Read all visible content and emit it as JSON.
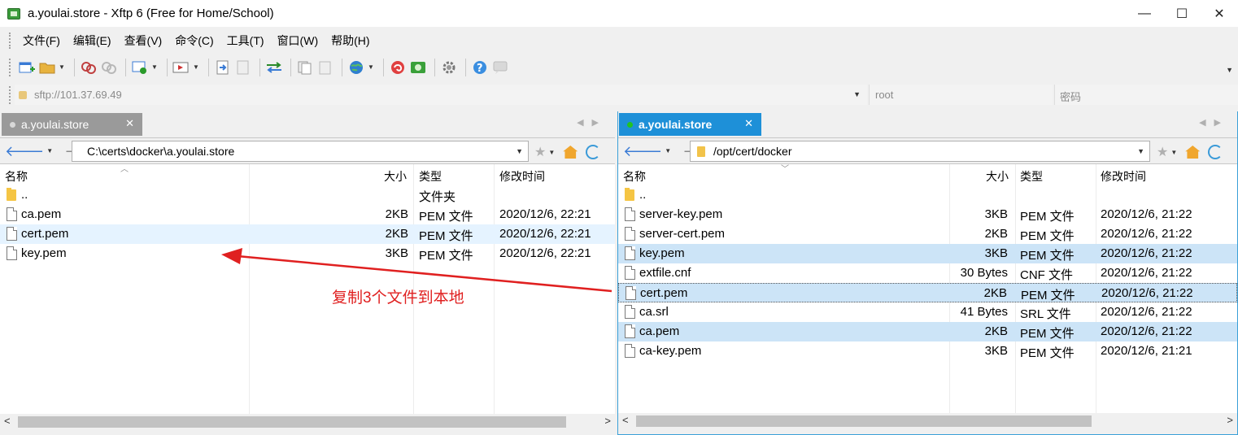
{
  "window": {
    "title": "a.youlai.store - Xftp 6 (Free for Home/School)",
    "minimize": "—",
    "maximize": "☐",
    "close": "✕"
  },
  "menu": [
    "文件(F)",
    "编辑(E)",
    "查看(V)",
    "命令(C)",
    "工具(T)",
    "窗口(W)",
    "帮助(H)"
  ],
  "address": {
    "host": "sftp://101.37.69.49",
    "user": "root",
    "password_placeholder": "密码"
  },
  "left": {
    "tab_label": "a.youlai.store",
    "path": "C:\\certs\\docker\\a.youlai.store",
    "columns": {
      "name": "名称",
      "size": "大小",
      "type": "类型",
      "modified": "修改时间"
    },
    "rows": [
      {
        "name": "..",
        "size": "",
        "type": "文件夹",
        "modified": "",
        "kind": "dir",
        "state": ""
      },
      {
        "name": "ca.pem",
        "size": "2KB",
        "type": "PEM 文件",
        "modified": "2020/12/6, 22:21",
        "kind": "file",
        "state": ""
      },
      {
        "name": "cert.pem",
        "size": "2KB",
        "type": "PEM 文件",
        "modified": "2020/12/6, 22:21",
        "kind": "file",
        "state": "hover"
      },
      {
        "name": "key.pem",
        "size": "3KB",
        "type": "PEM 文件",
        "modified": "2020/12/6, 22:21",
        "kind": "file",
        "state": ""
      }
    ]
  },
  "right": {
    "tab_label": "a.youlai.store",
    "path": "/opt/cert/docker",
    "columns": {
      "name": "名称",
      "size": "大小",
      "type": "类型",
      "modified": "修改时间"
    },
    "rows": [
      {
        "name": "..",
        "size": "",
        "type": "",
        "modified": "",
        "kind": "dir",
        "state": ""
      },
      {
        "name": "server-key.pem",
        "size": "3KB",
        "type": "PEM 文件",
        "modified": "2020/12/6, 21:22",
        "kind": "file",
        "state": ""
      },
      {
        "name": "server-cert.pem",
        "size": "2KB",
        "type": "PEM 文件",
        "modified": "2020/12/6, 21:22",
        "kind": "file",
        "state": ""
      },
      {
        "name": "key.pem",
        "size": "3KB",
        "type": "PEM 文件",
        "modified": "2020/12/6, 21:22",
        "kind": "file",
        "state": "sel"
      },
      {
        "name": "extfile.cnf",
        "size": "30 Bytes",
        "type": "CNF 文件",
        "modified": "2020/12/6, 21:22",
        "kind": "file",
        "state": ""
      },
      {
        "name": "cert.pem",
        "size": "2KB",
        "type": "PEM 文件",
        "modified": "2020/12/6, 21:22",
        "kind": "file",
        "state": "focus"
      },
      {
        "name": "ca.srl",
        "size": "41 Bytes",
        "type": "SRL 文件",
        "modified": "2020/12/6, 21:22",
        "kind": "file",
        "state": ""
      },
      {
        "name": "ca.pem",
        "size": "2KB",
        "type": "PEM 文件",
        "modified": "2020/12/6, 21:22",
        "kind": "file",
        "state": "sel"
      },
      {
        "name": "ca-key.pem",
        "size": "3KB",
        "type": "PEM 文件",
        "modified": "2020/12/6, 21:21",
        "kind": "file",
        "state": ""
      }
    ]
  },
  "annotation": {
    "text": "复制3个文件到本地",
    "color": "#e02020"
  },
  "colors": {
    "active_tab": "#1e90d8",
    "inactive_tab": "#9a9a9a",
    "selection": "#cce4f7"
  }
}
